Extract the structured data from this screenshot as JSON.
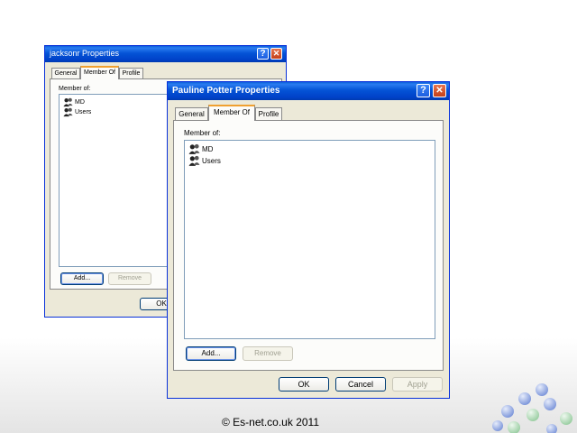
{
  "back_window": {
    "title": "jacksonr Properties",
    "help_glyph": "?",
    "close_glyph": "✕",
    "tabs": [
      {
        "label": "General",
        "active": false
      },
      {
        "label": "Member Of",
        "active": true
      },
      {
        "label": "Profile",
        "active": false
      }
    ],
    "member_of_label": "Member of:",
    "members": [
      {
        "name": "MD",
        "icon": "group-icon"
      },
      {
        "name": "Users",
        "icon": "group-icon"
      }
    ],
    "add_button": "Add...",
    "remove_button": "Remove",
    "ok_button": "OK"
  },
  "front_window": {
    "title": "Pauline Potter Properties",
    "help_glyph": "?",
    "close_glyph": "✕",
    "tabs": [
      {
        "label": "General",
        "active": false
      },
      {
        "label": "Member Of",
        "active": true
      },
      {
        "label": "Profile",
        "active": false
      }
    ],
    "member_of_label": "Member of:",
    "members": [
      {
        "name": "MD",
        "icon": "group-icon"
      },
      {
        "name": "Users",
        "icon": "group-icon"
      }
    ],
    "add_button": "Add...",
    "remove_button": "Remove",
    "ok_button": "OK",
    "cancel_button": "Cancel",
    "apply_button": "Apply"
  },
  "footer": {
    "copyright": "© Es-net.co.uk 2011"
  },
  "colors": {
    "titlebar": "#0453d6",
    "dialog_bg": "#ece9d8",
    "close_button": "#c4401a",
    "active_tab_accent": "#f0a030",
    "decoration_blue": "#8fa6e0",
    "decoration_green": "#a8d8b0"
  }
}
